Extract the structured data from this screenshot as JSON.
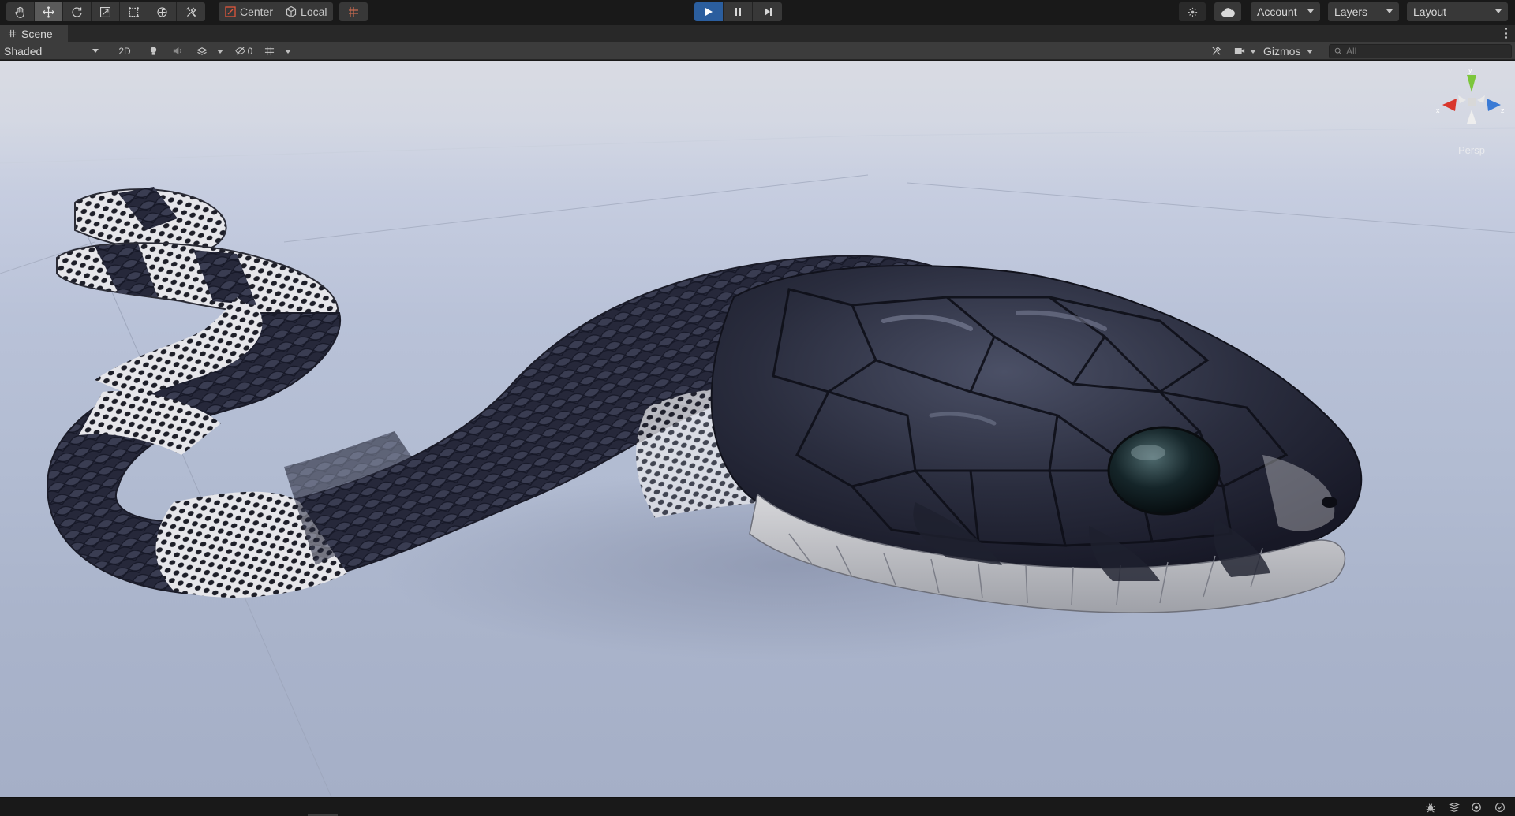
{
  "toolbar": {
    "tools": [
      "hand-tool",
      "move-tool",
      "rotate-tool",
      "scale-tool",
      "rect-tool",
      "transform-tool",
      "custom-editor-tool"
    ],
    "active_tool": "move-tool",
    "pivot_mode": "Center",
    "pivot_rotation": "Local",
    "play_state": "playing",
    "account_label": "Account",
    "layers_label": "Layers",
    "layout_label": "Layout"
  },
  "scene_tab": {
    "title": "Scene"
  },
  "scene_toolbar": {
    "draw_mode": "Shaded",
    "mode_2d_label": "2D",
    "hidden_count": "0",
    "gizmos_label": "Gizmos",
    "search_placeholder": "All"
  },
  "viewport": {
    "axis_labels": {
      "x": "x",
      "y": "y",
      "z": "z"
    },
    "projection_label": "Persp"
  },
  "colors": {
    "play_accent": "#2b5e9e",
    "axis_x": "#d9362c",
    "axis_y": "#7cc63b",
    "axis_z": "#3a7ad5"
  }
}
